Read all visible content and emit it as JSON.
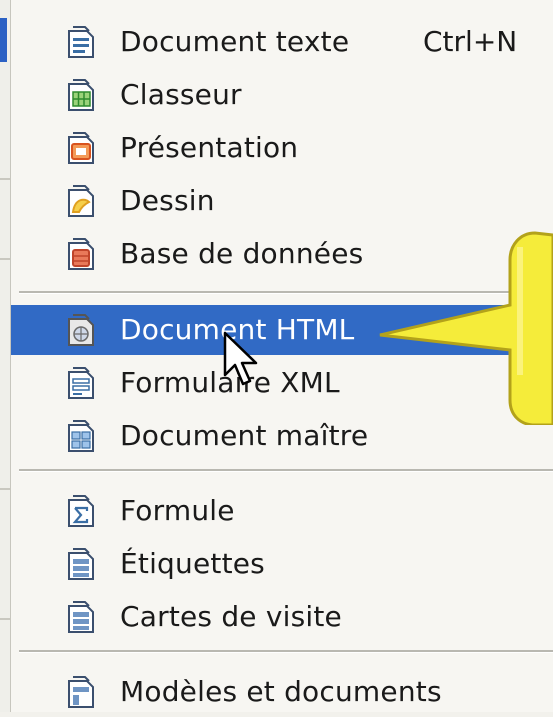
{
  "menu": {
    "items": [
      {
        "label": "Document texte",
        "shortcut": "Ctrl+N",
        "icon": "text-document-icon",
        "color": "#3a6ea5"
      },
      {
        "label": "Classeur",
        "icon": "spreadsheet-icon",
        "color": "#2e8b2e"
      },
      {
        "label": "Présentation",
        "icon": "presentation-icon",
        "color": "#d9531e"
      },
      {
        "label": "Dessin",
        "icon": "drawing-icon",
        "color": "#e0a020"
      },
      {
        "label": "Base de données",
        "icon": "database-icon",
        "color": "#c0442a"
      },
      {
        "label": "Document HTML",
        "icon": "html-document-icon",
        "color": "#6a6a6a",
        "highlighted": true
      },
      {
        "label": "Formulaire XML",
        "icon": "xml-form-icon",
        "color": "#3a6ea5"
      },
      {
        "label": "Document maître",
        "icon": "master-document-icon",
        "color": "#3a6ea5"
      },
      {
        "label": "Formule",
        "icon": "formula-icon",
        "color": "#3a6ea5"
      },
      {
        "label": "Étiquettes",
        "icon": "labels-icon",
        "color": "#3a6ea5"
      },
      {
        "label": "Cartes de visite",
        "icon": "business-cards-icon",
        "color": "#3a6ea5"
      },
      {
        "label": "Modèles et documents",
        "icon": "templates-icon",
        "color": "#3a6ea5"
      }
    ]
  },
  "colors": {
    "highlight": "#316ac5",
    "callout": "#f5ec3a"
  }
}
